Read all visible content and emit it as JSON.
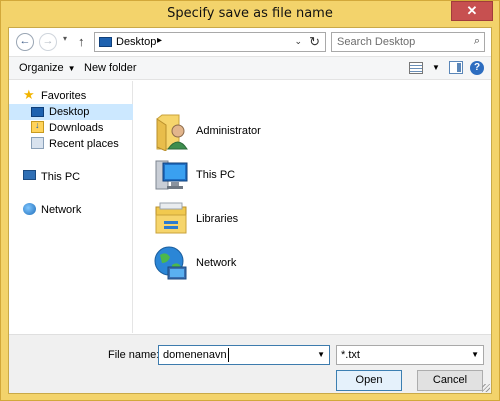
{
  "window": {
    "title": "Specify save as file name",
    "close_glyph": "✕"
  },
  "nav": {
    "back_glyph": "←",
    "forward_glyph": "→",
    "recent_glyph": "▾",
    "up_glyph": "↑"
  },
  "address": {
    "location": "Desktop",
    "separator": "▸",
    "dropdown_glyph": "⌄",
    "refresh_glyph": "↻"
  },
  "search": {
    "placeholder": "Search Desktop",
    "icon_glyph": "⌕"
  },
  "toolbar": {
    "organize_label": "Organize",
    "dropdown_glyph": "▼",
    "new_folder_label": "New folder",
    "help_glyph": "?"
  },
  "sidebar": {
    "items": [
      {
        "label": "Favorites",
        "icon": "star-icon"
      },
      {
        "label": "Desktop",
        "icon": "desktop-icon"
      },
      {
        "label": "Downloads",
        "icon": "downloads-icon"
      },
      {
        "label": "Recent places",
        "icon": "recent-places-icon"
      },
      {
        "label": "This PC",
        "icon": "pc-icon"
      },
      {
        "label": "Network",
        "icon": "network-icon"
      }
    ]
  },
  "files": {
    "items": [
      {
        "name": "Administrator",
        "icon": "user-folder-icon"
      },
      {
        "name": "This PC",
        "icon": "computer-icon"
      },
      {
        "name": "Libraries",
        "icon": "libraries-icon"
      },
      {
        "name": "Network",
        "icon": "network-globe-icon"
      }
    ]
  },
  "footer": {
    "file_name_label": "File name:",
    "file_name_value": "domenenavn",
    "file_type_value": "*.txt",
    "dropdown_glyph": "▼",
    "open_label": "Open",
    "cancel_label": "Cancel"
  },
  "colors": {
    "title_bar": "#f3d36b",
    "close_button": "#c75050",
    "selection": "#cce8ff",
    "accent_blue": "#1e62b0"
  }
}
